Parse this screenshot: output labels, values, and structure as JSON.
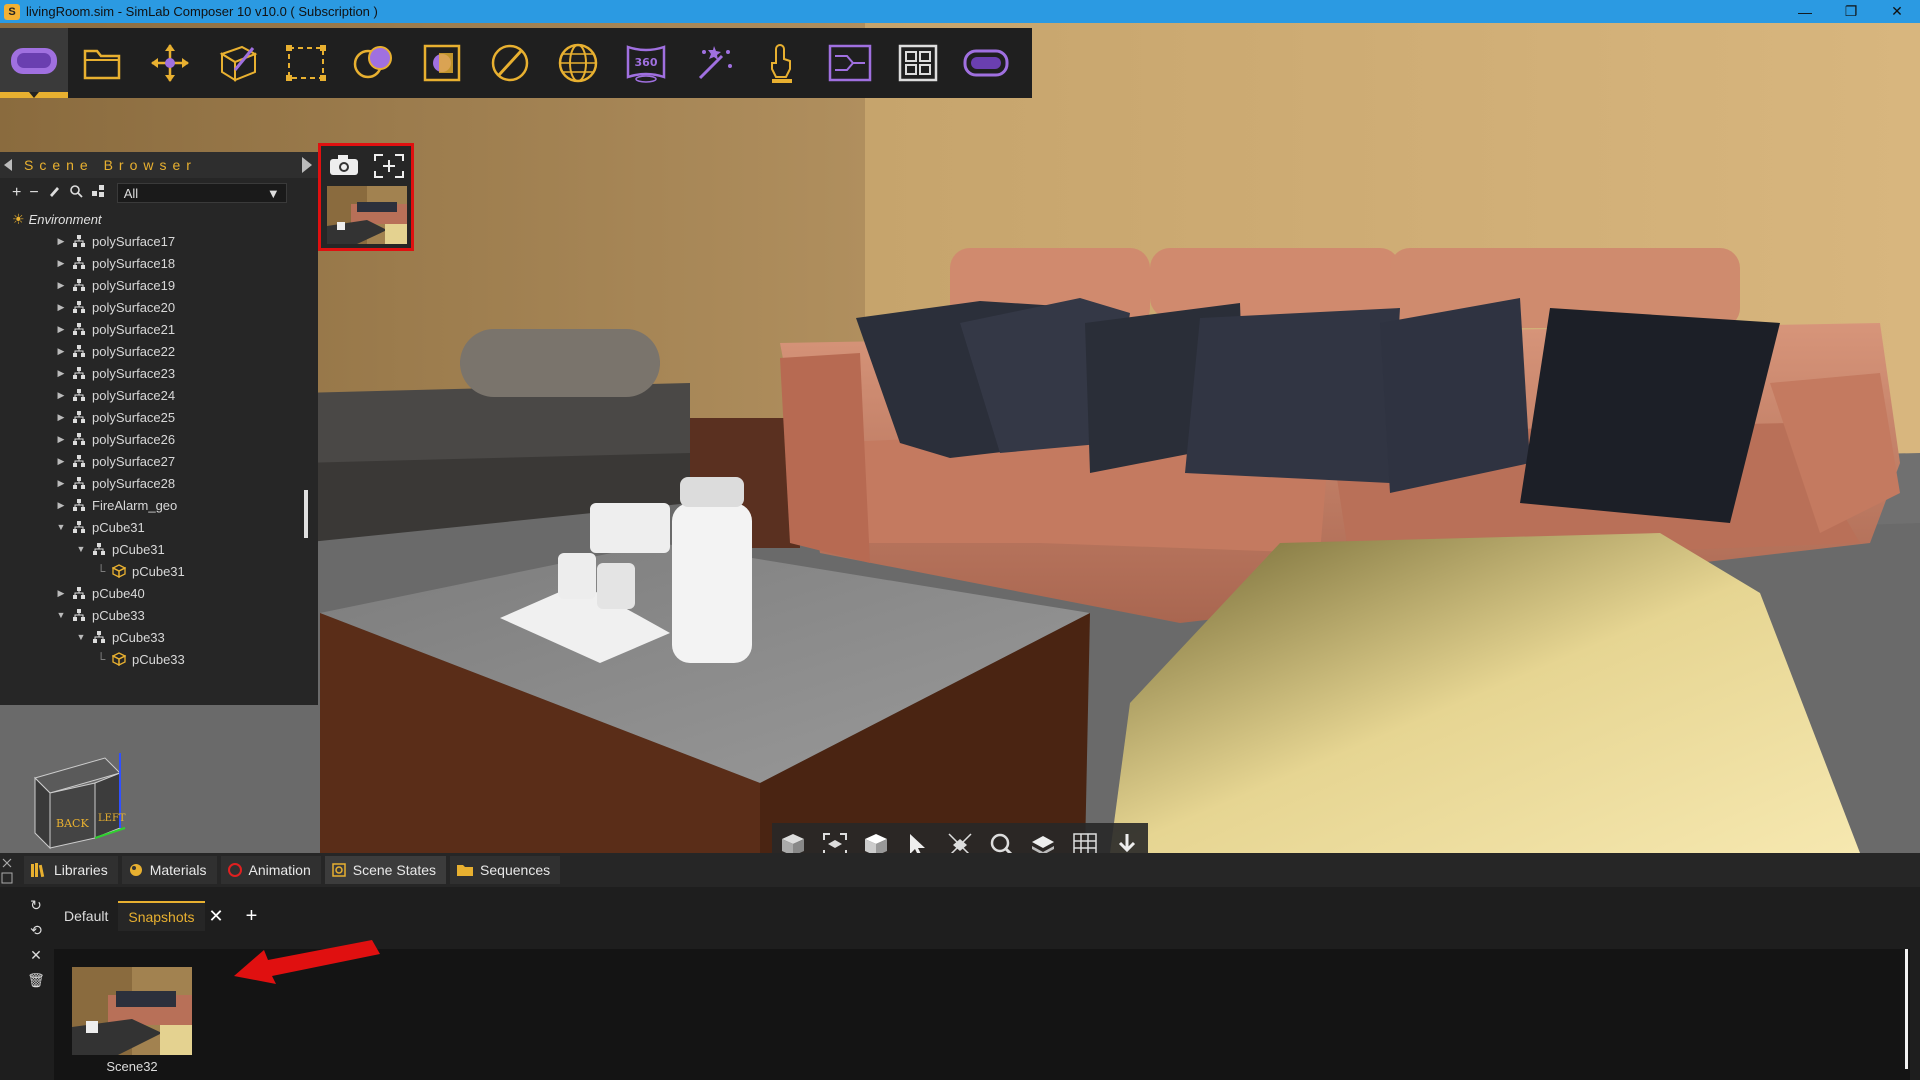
{
  "window": {
    "title": "livingRoom.sim - SimLab Composer 10 v10.0 ( Subscription )",
    "minimize": "—",
    "maximize": "❐",
    "close": "✕",
    "app_icon": "simlab-logo-icon"
  },
  "toolbar": {
    "buttons": [
      {
        "name": "vr-headset",
        "icon": "vr-headset-icon"
      },
      {
        "name": "scene-setup",
        "icon": "folder-icon"
      },
      {
        "name": "transform",
        "icon": "move-icon"
      },
      {
        "name": "modeling",
        "icon": "cube-pen-icon"
      },
      {
        "name": "selection",
        "icon": "dashed-selection-icon"
      },
      {
        "name": "materials",
        "icon": "spheres-icon"
      },
      {
        "name": "render",
        "icon": "render-frame-icon"
      },
      {
        "name": "lighting",
        "icon": "slash-circle-icon"
      },
      {
        "name": "environment",
        "icon": "globe-icon"
      },
      {
        "name": "panorama-360",
        "icon": "panorama-360-icon",
        "label": "360"
      },
      {
        "name": "effects",
        "icon": "magic-wand-icon"
      },
      {
        "name": "presenter",
        "icon": "presenter-icon"
      },
      {
        "name": "sequence",
        "icon": "sequence-icon"
      },
      {
        "name": "layout",
        "icon": "layout-grid-icon"
      },
      {
        "name": "vr-viewer",
        "icon": "vr-viewer-icon"
      }
    ]
  },
  "scene_browser": {
    "title": "Scene Browser",
    "filter": "All",
    "tools": [
      "+",
      "−"
    ],
    "environment_label": "Environment",
    "tree": [
      {
        "label": "polySurface17",
        "level": 1,
        "exp": "▶",
        "type": "group"
      },
      {
        "label": "polySurface18",
        "level": 1,
        "exp": "▶",
        "type": "group"
      },
      {
        "label": "polySurface19",
        "level": 1,
        "exp": "▶",
        "type": "group"
      },
      {
        "label": "polySurface20",
        "level": 1,
        "exp": "▶",
        "type": "group"
      },
      {
        "label": "polySurface21",
        "level": 1,
        "exp": "▶",
        "type": "group"
      },
      {
        "label": "polySurface22",
        "level": 1,
        "exp": "▶",
        "type": "group"
      },
      {
        "label": "polySurface23",
        "level": 1,
        "exp": "▶",
        "type": "group"
      },
      {
        "label": "polySurface24",
        "level": 1,
        "exp": "▶",
        "type": "group"
      },
      {
        "label": "polySurface25",
        "level": 1,
        "exp": "▶",
        "type": "group"
      },
      {
        "label": "polySurface26",
        "level": 1,
        "exp": "▶",
        "type": "group"
      },
      {
        "label": "polySurface27",
        "level": 1,
        "exp": "▶",
        "type": "group"
      },
      {
        "label": "polySurface28",
        "level": 1,
        "exp": "▶",
        "type": "group"
      },
      {
        "label": "FireAlarm_geo",
        "level": 1,
        "exp": "▶",
        "type": "group"
      },
      {
        "label": "pCube31",
        "level": 1,
        "exp": "▼",
        "type": "group"
      },
      {
        "label": "pCube31",
        "level": 2,
        "exp": "▼",
        "type": "group"
      },
      {
        "label": "pCube31",
        "level": 3,
        "exp": "",
        "type": "mesh"
      },
      {
        "label": "pCube40",
        "level": 1,
        "exp": "▶",
        "type": "group"
      },
      {
        "label": "pCube33",
        "level": 1,
        "exp": "▼",
        "type": "group"
      },
      {
        "label": "pCube33",
        "level": 2,
        "exp": "▼",
        "type": "group"
      },
      {
        "label": "pCube33",
        "level": 3,
        "exp": "",
        "type": "mesh"
      }
    ]
  },
  "snapshot_panel": {
    "camera_icon": "camera-icon",
    "add_icon": "add-frame-icon"
  },
  "nav_cube": {
    "back": "BACK",
    "left": "LEFT"
  },
  "viewport_toolbar": {
    "buttons": [
      "view-cube-icon",
      "fit-view-icon",
      "shading-cube-icon",
      "select-arrow-icon",
      "perspective-icon",
      "zoom-icon",
      "layers-icon",
      "grid-icon",
      "download-icon"
    ]
  },
  "bottom_panel": {
    "tabs": [
      {
        "label": "Libraries",
        "icon": "books-icon",
        "active": false
      },
      {
        "label": "Materials",
        "icon": "material-ball-icon",
        "active": false
      },
      {
        "label": "Animation",
        "icon": "animation-ring-icon",
        "active": false
      },
      {
        "label": "Scene States",
        "icon": "scene-states-icon",
        "active": true
      },
      {
        "label": "Sequences",
        "icon": "folder-sequence-icon",
        "active": false
      }
    ],
    "subtabs": {
      "default": "Default",
      "snapshots": "Snapshots",
      "close": "✕",
      "add": "+"
    },
    "left_tools": [
      "↻",
      "⟲",
      "✕",
      "🗑"
    ],
    "snapshots": [
      {
        "label": "Scene32"
      }
    ]
  },
  "colors": {
    "accent": "#e8b030",
    "titlebar": "#2b9ae2",
    "highlight_red": "#e01010",
    "icon_purple": "#a070e0",
    "icon_gold": "#e8b030"
  }
}
